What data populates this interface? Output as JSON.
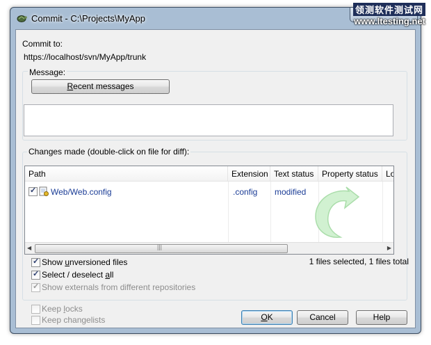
{
  "window": {
    "title": "Commit - C:\\Projects\\MyApp"
  },
  "watermark": {
    "line1": "领测软件测试网",
    "line2": "www.ltesting.net"
  },
  "commit": {
    "label": "Commit to:",
    "url": "https://localhost/svn/MyApp/trunk"
  },
  "message": {
    "group_label": "Message:",
    "recent_button": "Recent messages",
    "text": ""
  },
  "changes": {
    "group_label": "Changes made (double-click on file for diff):",
    "columns": [
      "Path",
      "Extension",
      "Text status",
      "Property status",
      "Lo"
    ],
    "rows": [
      {
        "checked": true,
        "path": "Web/Web.config",
        "extension": ".config",
        "text_status": "modified",
        "property_status": ""
      }
    ],
    "summary": "1 files selected, 1 files total"
  },
  "options": {
    "show_unversioned": {
      "label": "Show unversioned files",
      "checked": true
    },
    "select_all": {
      "label": "Select / deselect all",
      "checked": true
    },
    "show_externals": {
      "label": "Show externals from different repositories",
      "checked": true,
      "disabled": true
    },
    "keep_locks": {
      "label": "Keep locks",
      "checked": false,
      "disabled": true
    },
    "keep_changelists": {
      "label": "Keep changelists",
      "checked": false,
      "disabled": true
    }
  },
  "buttons": {
    "ok": "OK",
    "cancel": "Cancel",
    "help": "Help"
  },
  "colors": {
    "accent": "#1a3c96",
    "frame": "#a9bed4",
    "dialog_bg": "#f0f0f0"
  }
}
